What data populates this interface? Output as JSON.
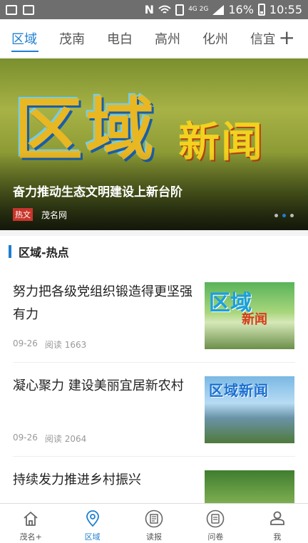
{
  "status_bar": {
    "network": "4G 2G",
    "battery": "16%",
    "time": "10:55"
  },
  "tabs": [
    {
      "label": "区域",
      "active": true
    },
    {
      "label": "茂南",
      "active": false
    },
    {
      "label": "电白",
      "active": false
    },
    {
      "label": "高州",
      "active": false
    },
    {
      "label": "化州",
      "active": false
    },
    {
      "label": "信宜",
      "active": false
    }
  ],
  "tab_add_label": "+",
  "banner": {
    "logo_main": "区域",
    "logo_sub": "新闻",
    "title": "奋力推动生态文明建设上新台阶",
    "tag": "热文",
    "source": "茂名网",
    "dots_count": 3,
    "active_dot": 1
  },
  "section": {
    "title": "区域-热点"
  },
  "articles": [
    {
      "title": "努力把各级党组织锻造得更坚强有力",
      "date": "09-26",
      "reads": "阅读 1663",
      "thumb_text_a": "区域",
      "thumb_text_b": "新闻"
    },
    {
      "title": "凝心聚力 建设美丽宜居新农村",
      "date": "09-26",
      "reads": "阅读 2064",
      "thumb_text_a": "区域新闻"
    },
    {
      "title": "持续发力推进乡村振兴"
    }
  ],
  "bottom_nav": [
    {
      "label": "茂名+",
      "icon": "home-icon",
      "active": false
    },
    {
      "label": "区域",
      "icon": "location-pin-icon",
      "active": true
    },
    {
      "label": "读报",
      "icon": "newspaper-icon",
      "active": false
    },
    {
      "label": "问卷",
      "icon": "survey-icon",
      "active": false
    },
    {
      "label": "我",
      "icon": "user-icon",
      "active": false
    }
  ],
  "colors": {
    "accent": "#1e7fd0",
    "hot_tag": "#c9352b",
    "status_bar": "#6e6e6e"
  }
}
